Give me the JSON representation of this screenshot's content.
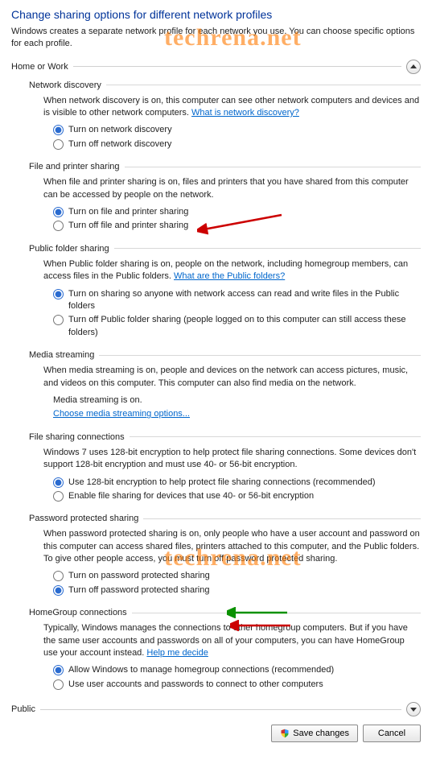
{
  "title": "Change sharing options for different network profiles",
  "description": "Windows creates a separate network profile for each network you use. You can choose specific options for each profile.",
  "watermark": "techrena.net",
  "profiles": {
    "home_work": {
      "label": "Home or Work"
    },
    "public": {
      "label": "Public"
    }
  },
  "sections": {
    "network_discovery": {
      "title": "Network discovery",
      "desc": "When network discovery is on, this computer can see other network computers and devices and is visible to other network computers. ",
      "link": "What is network discovery?",
      "opt_on": "Turn on network discovery",
      "opt_off": "Turn off network discovery"
    },
    "file_printer": {
      "title": "File and printer sharing",
      "desc": "When file and printer sharing is on, files and printers that you have shared from this computer can be accessed by people on the network.",
      "opt_on": "Turn on file and printer sharing",
      "opt_off": "Turn off file and printer sharing"
    },
    "public_folder": {
      "title": "Public folder sharing",
      "desc": "When Public folder sharing is on, people on the network, including homegroup members, can access files in the Public folders. ",
      "link": "What are the Public folders?",
      "opt_on": "Turn on sharing so anyone with network access can read and write files in the Public folders",
      "opt_off": "Turn off Public folder sharing (people logged on to this computer can still access these folders)"
    },
    "media_streaming": {
      "title": "Media streaming",
      "desc": "When media streaming is on, people and devices on the network can access pictures, music, and videos on this computer. This computer can also find media on the network.",
      "status": "Media streaming is on.",
      "link": "Choose media streaming options..."
    },
    "file_connections": {
      "title": "File sharing connections",
      "desc": "Windows 7 uses 128-bit encryption to help protect file sharing connections. Some devices don't support 128-bit encryption and must use 40- or 56-bit encryption.",
      "opt_on": "Use 128-bit encryption to help protect file sharing connections (recommended)",
      "opt_off": "Enable file sharing for devices that use 40- or 56-bit encryption"
    },
    "password": {
      "title": "Password protected sharing",
      "desc": "When password protected sharing is on, only people who have a user account and password on this computer can access shared files, printers attached to this computer, and the Public folders. To give other people access, you must turn off password protected sharing.",
      "opt_on": "Turn on password protected sharing",
      "opt_off": "Turn off password protected sharing"
    },
    "homegroup": {
      "title": "HomeGroup connections",
      "desc": "Typically, Windows manages the connections to other homegroup computers. But if you have the same user accounts and passwords on all of your computers, you can have HomeGroup use your account instead. ",
      "link": "Help me decide",
      "opt_on": "Allow Windows to manage homegroup connections (recommended)",
      "opt_off": "Use user accounts and passwords to connect to other computers"
    }
  },
  "buttons": {
    "save": "Save changes",
    "cancel": "Cancel"
  }
}
